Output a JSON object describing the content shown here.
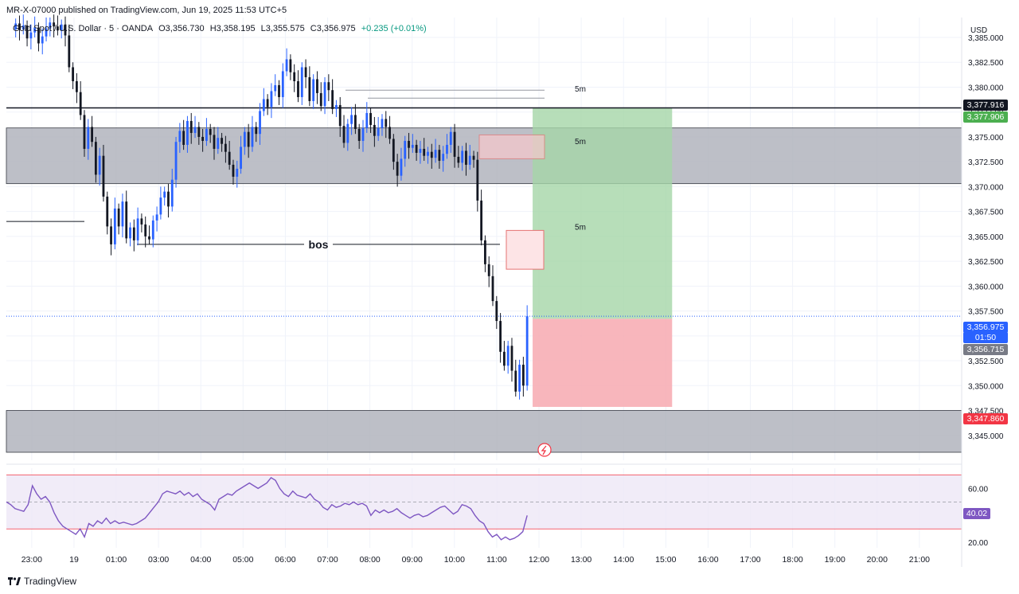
{
  "header": {
    "published": "MR-X-07000 published on TradingView.com, Jun 19, 2025 11:53 UTC+5",
    "symbol": "Gold Spot / U.S. Dollar · 5 · OANDA",
    "open": "O3,356.730",
    "high": "H3,358.195",
    "low": "L3,355.575",
    "close": "C3,356.975",
    "change": "+0.235 (+0.01%)"
  },
  "currency": "USD",
  "footer": {
    "brand": "TradingView"
  },
  "tags": {
    "level_black": "3,377.916",
    "tp": "3,377.906",
    "last_price": "3,356.975",
    "countdown": "01:50",
    "entry": "3,356.715",
    "stop": "3,347.860",
    "rsi_value": "40.02"
  },
  "annotations": {
    "bos": "bos",
    "tf1": "5m",
    "tf2": "5m",
    "tf3": "5m"
  },
  "colors": {
    "up": "#2962ff",
    "down": "#131722",
    "zone": "#b2b5be",
    "tp_zone": "#a5d6a7",
    "sl_zone": "#f7a9b0",
    "rsi": "#7e57c2",
    "rsi_band": "#ede7f6"
  },
  "chart_data": [
    {
      "type": "candlestick",
      "title": "Gold Spot / U.S. Dollar · 5 · OANDA",
      "ylabel": "USD",
      "ylim": [
        3342.5,
        3387.0
      ],
      "y_ticks": [
        "3,385.000",
        "3,382.500",
        "3,380.000",
        "3,377.500",
        "3,375.000",
        "3,372.500",
        "3,370.000",
        "3,367.500",
        "3,365.000",
        "3,362.500",
        "3,360.000",
        "3,357.500",
        "3,355.000",
        "3,352.500",
        "3,350.000",
        "3,347.500",
        "3,345.000"
      ],
      "y_tick_values": [
        3385,
        3382.5,
        3380,
        3377.5,
        3375,
        3372.5,
        3370,
        3367.5,
        3365,
        3362.5,
        3360,
        3357.5,
        3355,
        3352.5,
        3350,
        3347.5,
        3345
      ],
      "x_ticks": [
        "23:00",
        "19",
        "01:00",
        "03:00",
        "04:00",
        "05:00",
        "06:00",
        "07:00",
        "08:00",
        "09:00",
        "10:00",
        "11:00",
        "12:00",
        "13:00",
        "14:00",
        "15:00",
        "16:00",
        "17:00",
        "18:00",
        "19:00",
        "20:00",
        "21:00"
      ],
      "x_tick_hours": [
        -1,
        0,
        1,
        2,
        3,
        4,
        5,
        6,
        7,
        8,
        9,
        10,
        11,
        12,
        13,
        14,
        15,
        16,
        17,
        18,
        19,
        20
      ],
      "x_hour_range": [
        -1.6,
        21.0
      ],
      "closes": [
        3386.4,
        3385.8,
        3386.2,
        3384.9,
        3385.5,
        3386.0,
        3384.4,
        3385.1,
        3385.9,
        3386.5,
        3386.1,
        3385.7,
        3386.3,
        3385.2,
        3382.0,
        3380.6,
        3379.5,
        3377.2,
        3373.8,
        3376.0,
        3374.5,
        3371.2,
        3373.1,
        3369.0,
        3366.0,
        3364.2,
        3367.8,
        3366.0,
        3368.5,
        3364.8,
        3365.9,
        3364.6,
        3366.8,
        3366.2,
        3365.0,
        3364.7,
        3366.6,
        3367.2,
        3368.9,
        3369.5,
        3368.0,
        3370.7,
        3374.5,
        3375.6,
        3374.2,
        3376.6,
        3375.4,
        3376.0,
        3375.0,
        3374.6,
        3375.8,
        3375.2,
        3373.8,
        3374.9,
        3374.3,
        3373.5,
        3372.2,
        3371.0,
        3371.8,
        3374.0,
        3375.5,
        3374.0,
        3376.0,
        3375.3,
        3377.6,
        3378.8,
        3378.0,
        3379.6,
        3380.2,
        3379.0,
        3381.6,
        3382.8,
        3381.5,
        3380.6,
        3379.0,
        3382.0,
        3381.0,
        3378.6,
        3380.8,
        3379.4,
        3378.1,
        3380.5,
        3379.7,
        3377.8,
        3378.2,
        3376.1,
        3374.4,
        3376.3,
        3377.2,
        3375.8,
        3374.6,
        3375.9,
        3377.4,
        3376.2,
        3375.1,
        3375.9,
        3376.8,
        3376.0,
        3374.8,
        3372.5,
        3371.1,
        3372.8,
        3374.6,
        3373.9,
        3374.2,
        3373.4,
        3373.8,
        3373.1,
        3373.5,
        3372.9,
        3373.7,
        3372.6,
        3373.3,
        3374.2,
        3375.5,
        3373.0,
        3372.4,
        3373.6,
        3372.2,
        3373.1,
        3372.7,
        3368.6,
        3364.6,
        3362.2,
        3361.0,
        3358.5,
        3356.5,
        3353.4,
        3352.0,
        3354.0,
        3351.5,
        3349.4,
        3352.1,
        3350.0,
        3356.975
      ],
      "horizontal_levels": [
        {
          "name": "key-level",
          "value": 3377.916
        },
        {
          "name": "bos-line",
          "value": 3364.2
        },
        {
          "name": "left-level",
          "value": 3366.5
        }
      ],
      "zones": [
        {
          "name": "supply-zone",
          "from": 3370.3,
          "to": 3375.9
        },
        {
          "name": "demand-zone",
          "from": 3343.3,
          "to": 3347.5
        }
      ],
      "position": {
        "type": "long",
        "entry": 3356.715,
        "take_profit": 3377.906,
        "stop": 3347.86,
        "from_hour": 10.85,
        "to_hour": 14.15
      }
    },
    {
      "type": "line",
      "title": "RSI",
      "ylim": [
        16,
        75
      ],
      "y_ticks": [
        "60.00",
        "20.00"
      ],
      "y_tick_values": [
        60,
        20
      ],
      "bands": [
        30,
        70
      ],
      "midline": 50,
      "values": [
        50,
        48,
        45,
        44,
        43,
        48,
        62,
        56,
        52,
        54,
        50,
        42,
        36,
        32,
        30,
        28,
        26,
        30,
        24,
        34,
        32,
        36,
        34,
        38,
        34,
        36,
        34,
        35,
        34,
        33,
        34,
        36,
        38,
        42,
        46,
        50,
        56,
        58,
        57,
        56,
        58,
        55,
        57,
        54,
        56,
        52,
        50,
        48,
        44,
        52,
        54,
        56,
        55,
        58,
        60,
        62,
        64,
        62,
        60,
        62,
        64,
        68,
        66,
        60,
        56,
        54,
        58,
        55,
        54,
        53,
        56,
        52,
        50,
        46,
        44,
        48,
        46,
        47,
        49,
        48,
        50,
        48,
        49,
        47,
        40,
        44,
        42,
        44,
        42,
        43,
        45,
        42,
        40,
        38,
        40,
        41,
        39,
        40,
        42,
        44,
        46,
        47,
        44,
        41,
        43,
        48,
        47,
        45,
        40,
        36,
        34,
        28,
        24,
        26,
        22,
        24,
        22,
        23,
        25,
        28,
        40.02
      ]
    }
  ]
}
